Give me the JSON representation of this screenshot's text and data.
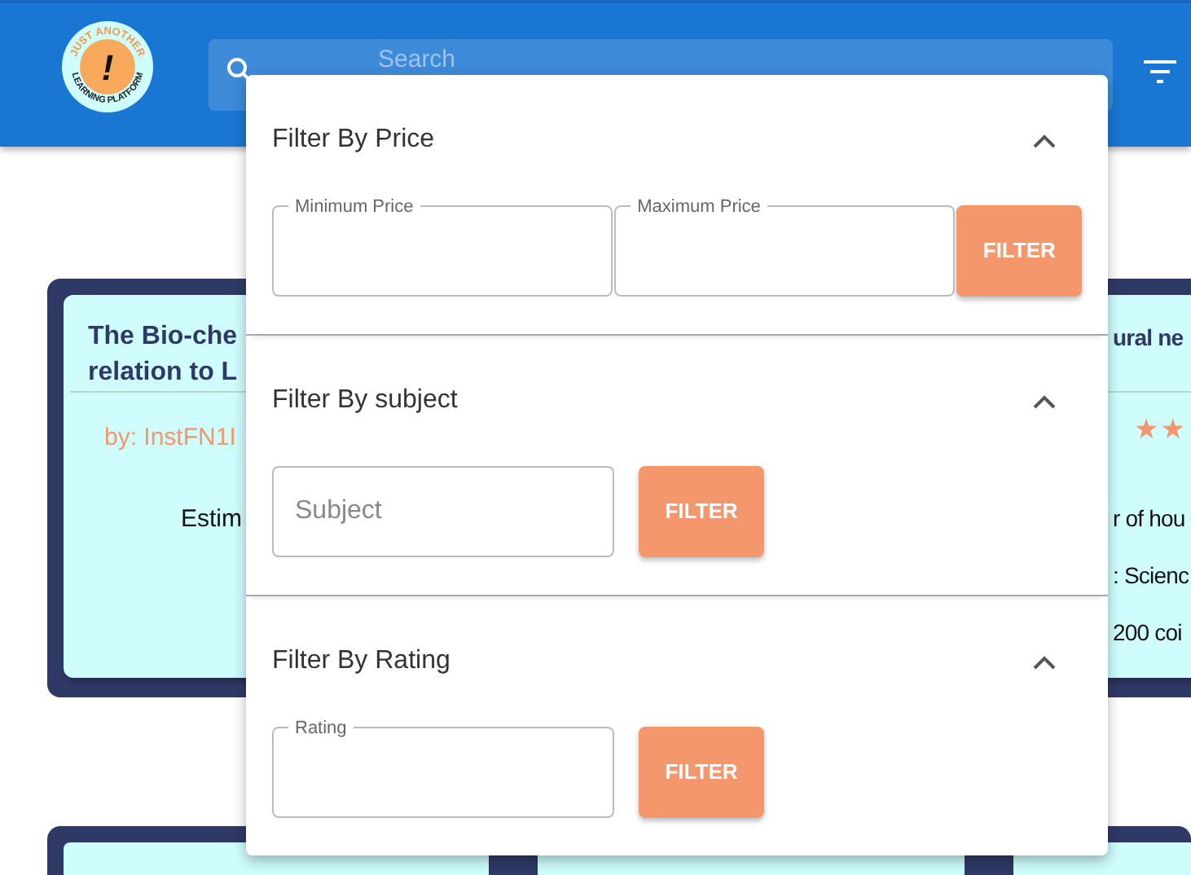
{
  "header": {
    "logo": {
      "mark": "!",
      "ring_top": "JUST ANOTHER",
      "ring_bottom": "LEARNING PLATFORM"
    },
    "search": {
      "placeholder": "Search"
    }
  },
  "cards": [
    {
      "title_lines": [
        "The Bio-che",
        "relation to L"
      ],
      "author": "by: InstFN1I",
      "lines": [
        "Estim"
      ]
    },
    {
      "title_lines": [
        "ural ne"
      ],
      "star_glyphs": [
        "★",
        "★"
      ],
      "lines": [
        "r of hou",
        ": Scienc",
        "200 coi"
      ]
    }
  ],
  "filter_panel": {
    "sections": [
      {
        "title": "Filter By Price",
        "expanded": true,
        "fields": [
          {
            "kind": "outlined",
            "label": "Minimum Price"
          },
          {
            "kind": "outlined",
            "label": "Maximum Price"
          }
        ],
        "button": "FILTER"
      },
      {
        "title": "Filter By subject",
        "expanded": true,
        "fields": [
          {
            "kind": "plain",
            "placeholder": "Subject"
          }
        ],
        "button": "FILTER"
      },
      {
        "title": "Filter By Rating",
        "expanded": true,
        "fields": [
          {
            "kind": "outlined",
            "label": "Rating"
          }
        ],
        "button": "FILTER"
      }
    ]
  }
}
